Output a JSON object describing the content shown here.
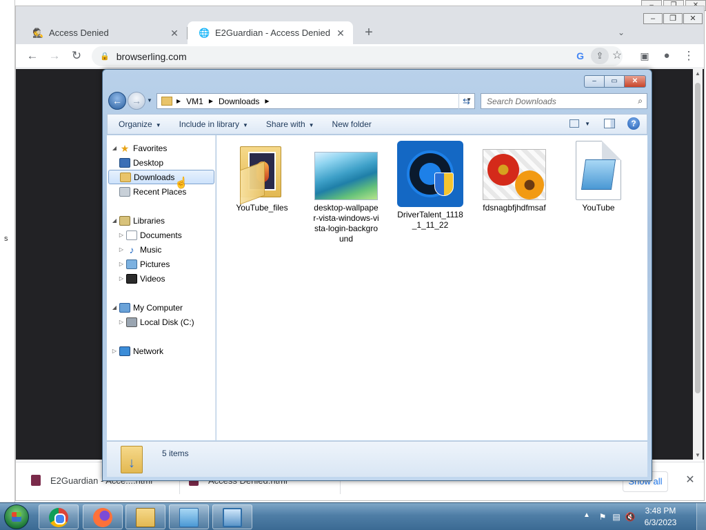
{
  "browser": {
    "tabs": [
      {
        "title": "Access Denied",
        "active": false
      },
      {
        "title": "E2Guardian - Access Denied",
        "active": true
      }
    ],
    "url": "browserling.com",
    "downloads": [
      {
        "name": "E2Guardian - Acce....html"
      },
      {
        "name": "Access Denied.html"
      }
    ],
    "show_all_label": "Show all"
  },
  "explorer": {
    "breadcrumb": [
      "VM1",
      "Downloads"
    ],
    "search_placeholder": "Search Downloads",
    "commands": [
      "Organize",
      "Include in library",
      "Share with",
      "New folder"
    ],
    "nav_tree": {
      "favorites": "Favorites",
      "desktop": "Desktop",
      "downloads": "Downloads",
      "recent_places": "Recent Places",
      "libraries": "Libraries",
      "documents": "Documents",
      "music": "Music",
      "pictures": "Pictures",
      "videos": "Videos",
      "my_computer": "My Computer",
      "local_disk": "Local Disk (C:)",
      "network": "Network"
    },
    "files": [
      {
        "name": "YouTube_files",
        "kind": "folder"
      },
      {
        "name": "desktop-wallpaper-vista-windows-vista-login-background",
        "kind": "image"
      },
      {
        "name": "DriverTalent_1118_1_11_22",
        "kind": "application"
      },
      {
        "name": "fdsnagbfjhdfmsaf",
        "kind": "image"
      },
      {
        "name": "YouTube",
        "kind": "text"
      }
    ],
    "status_count": "5 items"
  },
  "taskbar": {
    "apps": [
      "chrome",
      "firefox",
      "explorer",
      "notepad",
      "photo-viewer"
    ],
    "clock_time": "3:48 PM",
    "clock_date": "6/3/2023"
  },
  "colors": {
    "page_dark": "#222225",
    "win7_frame": "#b9d1ea",
    "taskbar": "#4f7ea6",
    "link_blue": "#1a73e8"
  }
}
